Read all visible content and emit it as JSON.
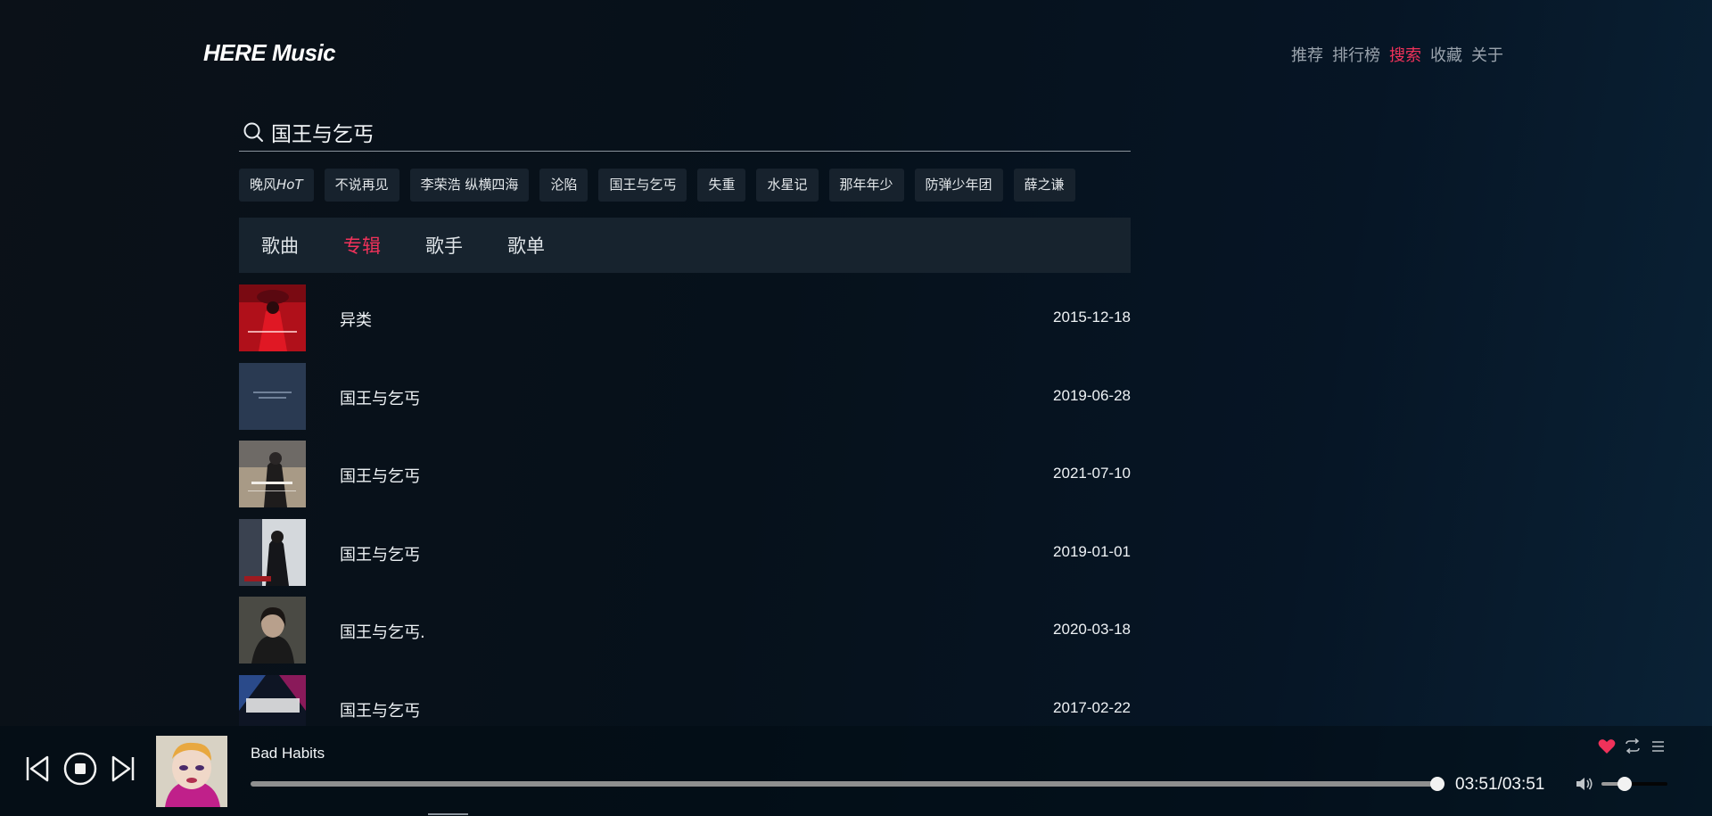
{
  "app": {
    "logo": "HERE Music"
  },
  "nav": [
    {
      "label": "推荐",
      "active": false
    },
    {
      "label": "排行榜",
      "active": false
    },
    {
      "label": "搜索",
      "active": true
    },
    {
      "label": "收藏",
      "active": false
    },
    {
      "label": "关于",
      "active": false
    }
  ],
  "search": {
    "value": "国王与乞丐",
    "icon": "search-icon"
  },
  "hot_tags": [
    "晚风HoT",
    "不说再见",
    "李荣浩 纵横四海",
    "沦陷",
    "国王与乞丐",
    "失重",
    "水星记",
    "那年年少",
    "防弹少年团",
    "薛之谦"
  ],
  "tabs": [
    {
      "label": "歌曲",
      "active": false
    },
    {
      "label": "专辑",
      "active": true
    },
    {
      "label": "歌手",
      "active": false
    },
    {
      "label": "歌单",
      "active": false
    }
  ],
  "albums": [
    {
      "title": "异类",
      "date": "2015-12-18"
    },
    {
      "title": "国王与乞丐",
      "date": "2019-06-28"
    },
    {
      "title": "国王与乞丐",
      "date": "2021-07-10"
    },
    {
      "title": "国王与乞丐",
      "date": "2019-01-01"
    },
    {
      "title": "国王与乞丐.",
      "date": "2020-03-18"
    },
    {
      "title": "国王与乞丐",
      "date": "2017-02-22"
    }
  ],
  "player": {
    "track_title": "Bad Habits",
    "time": "03:51/03:51",
    "progress": 1.0,
    "volume": 0.35,
    "liked": true
  },
  "colors": {
    "accent": "#f0325a",
    "tag_bg": "#17222d",
    "tab_bar_bg": "#17232e"
  }
}
